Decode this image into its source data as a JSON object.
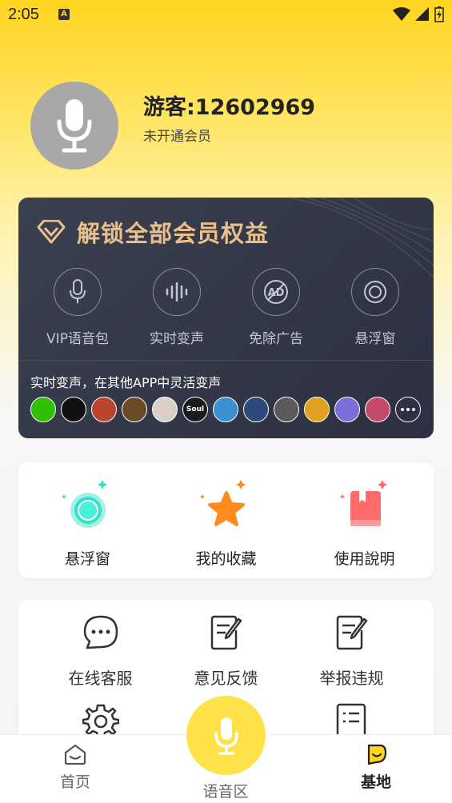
{
  "status_bar": {
    "time": "2:05",
    "notif_icon": "A"
  },
  "profile": {
    "username": "游客:12602969",
    "membership": "未开通会员"
  },
  "vip": {
    "title": "解锁全部会员权益",
    "features": [
      {
        "label": "VIP语音包",
        "icon": "mic-icon"
      },
      {
        "label": "实时变声",
        "icon": "waveform-icon"
      },
      {
        "label": "免除广告",
        "icon": "no-ad-icon"
      },
      {
        "label": "悬浮窗",
        "icon": "float-window-icon"
      }
    ],
    "subtitle": "实时变声，在其他APP中灵活变声",
    "apps": [
      {
        "name": "wechat",
        "color": "#2DC100",
        "text": ""
      },
      {
        "name": "qq",
        "color": "#111111",
        "text": ""
      },
      {
        "name": "game-1",
        "color": "#B8452C",
        "text": ""
      },
      {
        "name": "game-2",
        "color": "#6B4A2A",
        "text": ""
      },
      {
        "name": "game-3",
        "color": "#D9D0C8",
        "text": ""
      },
      {
        "name": "soul",
        "color": "#1B1B1B",
        "text": "Soul"
      },
      {
        "name": "game-4",
        "color": "#3C8FD0",
        "text": ""
      },
      {
        "name": "game-5",
        "color": "#2E4A7A",
        "text": ""
      },
      {
        "name": "game-6",
        "color": "#5A5A5A",
        "text": ""
      },
      {
        "name": "game-7",
        "color": "#E0A020",
        "text": ""
      },
      {
        "name": "game-8",
        "color": "#7A6FD8",
        "text": ""
      },
      {
        "name": "game-9",
        "color": "#C44A6A",
        "text": ""
      }
    ]
  },
  "quick_actions": [
    {
      "label": "悬浮窗"
    },
    {
      "label": "我的收藏"
    },
    {
      "label": "使用說明"
    }
  ],
  "services": [
    {
      "label": "在线客服"
    },
    {
      "label": "意见反馈"
    },
    {
      "label": "举报违规"
    }
  ],
  "nav": {
    "home": "首页",
    "voice": "语音区",
    "base": "基地"
  },
  "colors": {
    "accent": "#FFD51F",
    "vip_gold": "#E9C089",
    "vip_bg": "#2F3444"
  }
}
